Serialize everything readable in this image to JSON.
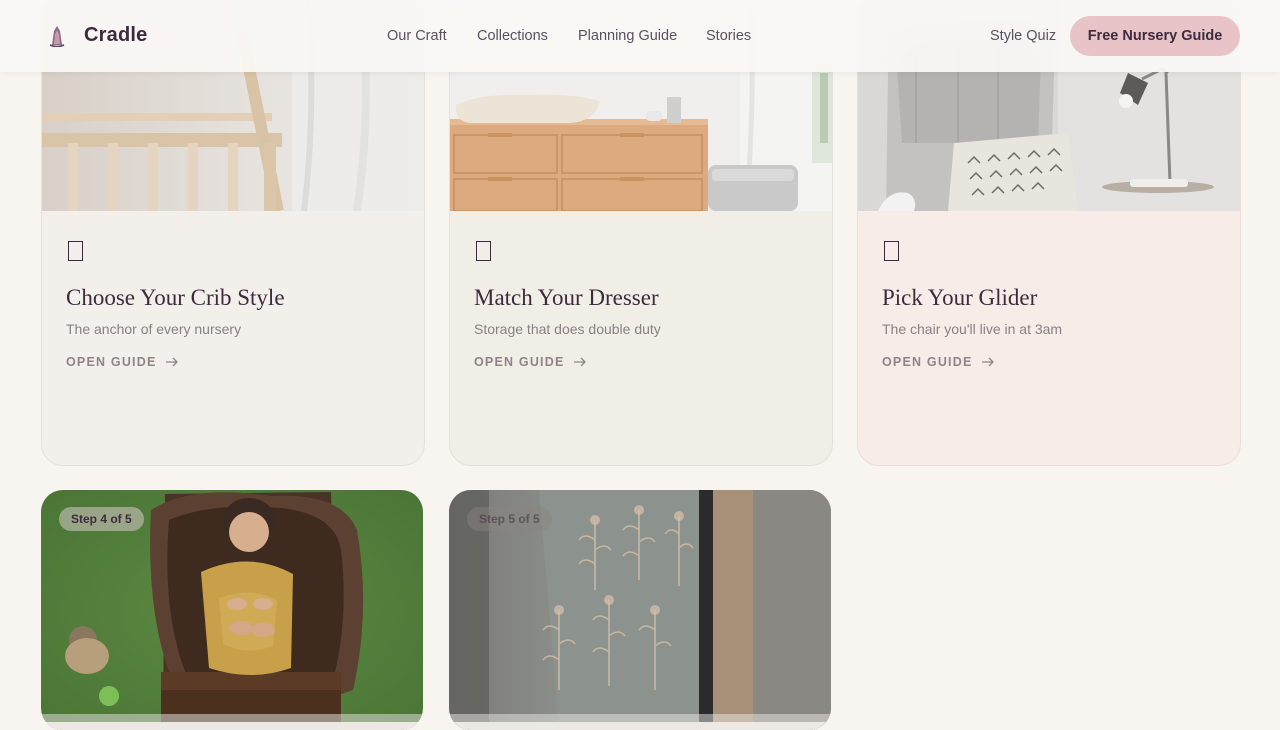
{
  "header": {
    "brand": "Cradle",
    "logo_icon": "rocking-horse-icon",
    "nav": [
      "Our Craft",
      "Collections",
      "Planning Guide",
      "Stories"
    ],
    "quiz": "Style Quiz",
    "cta": "Free Nursery Guide"
  },
  "colors": {
    "accent": "#e8c4c8",
    "text": "#3d2b3d",
    "background": "#f8f5f1"
  },
  "cards": [
    {
      "title": "Choose Your Crib Style",
      "subtitle": "The anchor of every nursery",
      "link": "OPEN GUIDE",
      "icon": "guide-icon",
      "image": "crib-photo"
    },
    {
      "title": "Match Your Dresser",
      "subtitle": "Storage that does double duty",
      "link": "OPEN GUIDE",
      "icon": "guide-icon",
      "image": "dresser-photo"
    },
    {
      "title": "Pick Your Glider",
      "subtitle": "The chair you'll live in at 3am",
      "link": "OPEN GUIDE",
      "icon": "guide-icon",
      "image": "glider-photo"
    }
  ],
  "photo_cards": [
    {
      "badge": "Step 4 of 5",
      "image": "newborn-photo"
    },
    {
      "badge": "Step 5 of 5",
      "image": "botanical-wall-photo"
    }
  ]
}
